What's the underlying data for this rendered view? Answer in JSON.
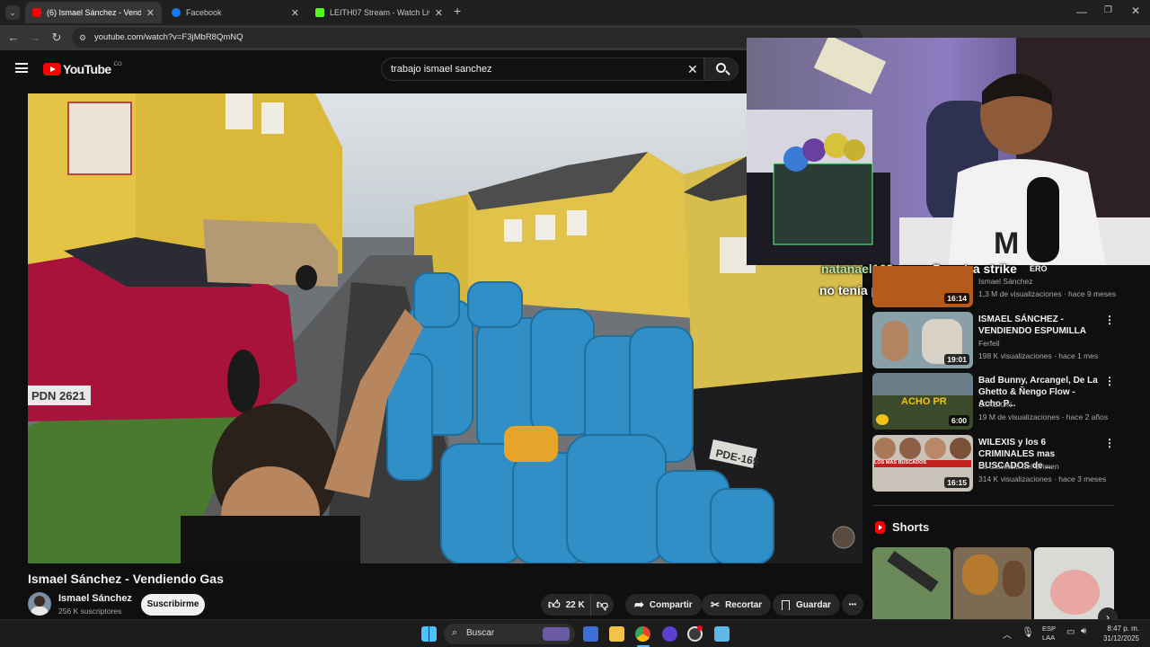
{
  "browser": {
    "tabs": [
      {
        "title": "(6) Ismael Sánchez - Vendiendo",
        "active": true,
        "favicon_color": "#ff0000"
      },
      {
        "title": "Facebook",
        "active": false,
        "favicon_color": "#1877f2"
      },
      {
        "title": "LEITH07 Stream - Watch Live o",
        "active": false,
        "favicon_color": "#53fc18"
      }
    ],
    "new_tab": "+",
    "url": "youtube.com/watch?v=F3jMbR8QmNQ"
  },
  "youtube": {
    "logo_text": "YouTube",
    "country": "CO",
    "search_value": "trabajo ismael sanchez"
  },
  "video": {
    "title": "Ismael Sánchez - Vendiendo Gas",
    "plates": [
      "PDN 2621",
      "PDE-165"
    ],
    "channel": {
      "name": "Ismael Sánchez",
      "subscribers": "256 K suscriptores",
      "subscribe_label": "Suscribirme"
    },
    "actions": {
      "likes": "22 K",
      "share": "Compartir",
      "clip": "Recortar",
      "save": "Guardar",
      "more": "•••"
    }
  },
  "stream_overlay": {
    "chat_user": "natanael163",
    "chat_line1": ": pero Countra strike",
    "chat_line2": "no tenía padrote"
  },
  "sidebar": {
    "partial_title": "ERO",
    "items": [
      {
        "title": "",
        "channel": "Ismael Sánchez",
        "meta": "1,3 M de visualizaciones · hace 9 meses",
        "duration": "16:14",
        "thumb": "#b35a1c"
      },
      {
        "title": "ISMAEL SÁNCHEZ - VENDIENDO ESPUMILLA",
        "channel": "Ferfell",
        "meta": "198 K visualizaciones · hace 1 mes",
        "duration": "19:01",
        "thumb": "#8aa0a8"
      },
      {
        "title": "Bad Bunny, Arcangel, De La Ghetto & Ñengo Flow - Acho P...",
        "channel": "STACION",
        "meta": "19 M de visualizaciones · hace 2 años",
        "duration": "6:00",
        "thumb": "#3b4a2a",
        "thumb_text": "ACHO PR"
      },
      {
        "title": "WILEXIS y los 6 CRIMINALES mas BUSCADOS de ...",
        "channel": "La Clavicula del Crimen",
        "meta": "314 K visualizaciones · hace 3 meses",
        "duration": "16:15",
        "thumb": "#c9c2b8",
        "thumb_text": "LOS MAS BUSCADOS"
      }
    ],
    "shorts_label": "Shorts"
  },
  "taskbar": {
    "search_placeholder": "Buscar",
    "lang": "ESP",
    "lang2": "LAA",
    "time": "8:47 p. m.",
    "date": "31/12/2025"
  },
  "colors": {
    "yt_red": "#ff0000",
    "bg": "#0f0f0f",
    "chat_user": "#b5e3a8"
  }
}
